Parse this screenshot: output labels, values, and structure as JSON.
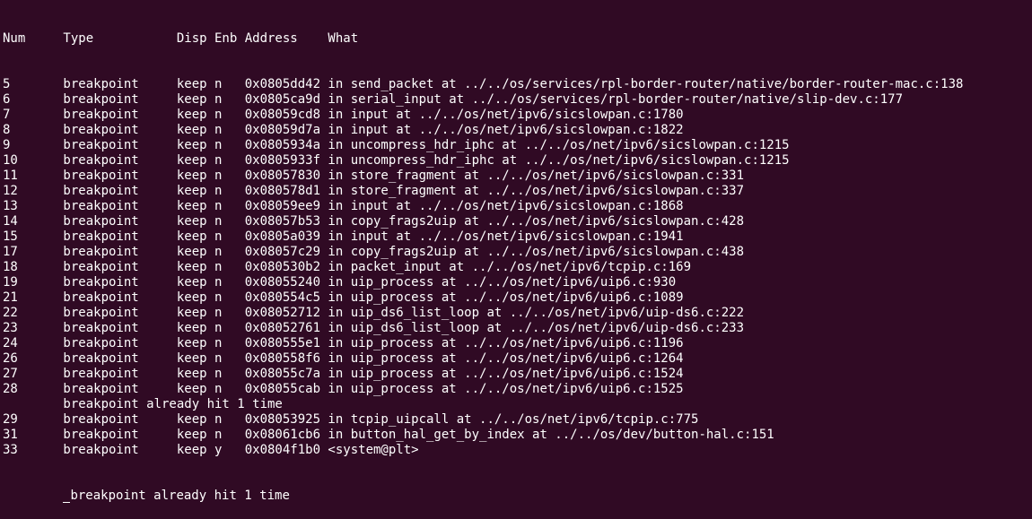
{
  "header": "Num     Type           Disp Enb Address    What",
  "rows": [
    "5       breakpoint     keep n   0x0805dd42 in send_packet at ../../os/services/rpl-border-router/native/border-router-mac.c:138",
    "6       breakpoint     keep n   0x0805ca9d in serial_input at ../../os/services/rpl-border-router/native/slip-dev.c:177",
    "7       breakpoint     keep n   0x08059cd8 in input at ../../os/net/ipv6/sicslowpan.c:1780",
    "8       breakpoint     keep n   0x08059d7a in input at ../../os/net/ipv6/sicslowpan.c:1822",
    "9       breakpoint     keep n   0x0805934a in uncompress_hdr_iphc at ../../os/net/ipv6/sicslowpan.c:1215",
    "10      breakpoint     keep n   0x0805933f in uncompress_hdr_iphc at ../../os/net/ipv6/sicslowpan.c:1215",
    "11      breakpoint     keep n   0x08057830 in store_fragment at ../../os/net/ipv6/sicslowpan.c:331",
    "12      breakpoint     keep n   0x080578d1 in store_fragment at ../../os/net/ipv6/sicslowpan.c:337",
    "13      breakpoint     keep n   0x08059ee9 in input at ../../os/net/ipv6/sicslowpan.c:1868",
    "14      breakpoint     keep n   0x08057b53 in copy_frags2uip at ../../os/net/ipv6/sicslowpan.c:428",
    "15      breakpoint     keep n   0x0805a039 in input at ../../os/net/ipv6/sicslowpan.c:1941",
    "17      breakpoint     keep n   0x08057c29 in copy_frags2uip at ../../os/net/ipv6/sicslowpan.c:438",
    "18      breakpoint     keep n   0x080530b2 in packet_input at ../../os/net/ipv6/tcpip.c:169",
    "19      breakpoint     keep n   0x08055240 in uip_process at ../../os/net/ipv6/uip6.c:930",
    "21      breakpoint     keep n   0x080554c5 in uip_process at ../../os/net/ipv6/uip6.c:1089",
    "22      breakpoint     keep n   0x08052712 in uip_ds6_list_loop at ../../os/net/ipv6/uip-ds6.c:222",
    "23      breakpoint     keep n   0x08052761 in uip_ds6_list_loop at ../../os/net/ipv6/uip-ds6.c:233",
    "24      breakpoint     keep n   0x080555e1 in uip_process at ../../os/net/ipv6/uip6.c:1196",
    "26      breakpoint     keep n   0x080558f6 in uip_process at ../../os/net/ipv6/uip6.c:1264",
    "27      breakpoint     keep n   0x08055c7a in uip_process at ../../os/net/ipv6/uip6.c:1524",
    "28      breakpoint     keep n   0x08055cab in uip_process at ../../os/net/ipv6/uip6.c:1525",
    "        breakpoint already hit 1 time",
    "29      breakpoint     keep n   0x08053925 in tcpip_uipcall at ../../os/net/ipv6/tcpip.c:775",
    "31      breakpoint     keep n   0x08061cb6 in button_hal_get_by_index at ../../os/dev/button-hal.c:151",
    "33      breakpoint     keep y   0x0804f1b0 <system@plt>"
  ],
  "last_line": "breakpoint already hit 1 time"
}
